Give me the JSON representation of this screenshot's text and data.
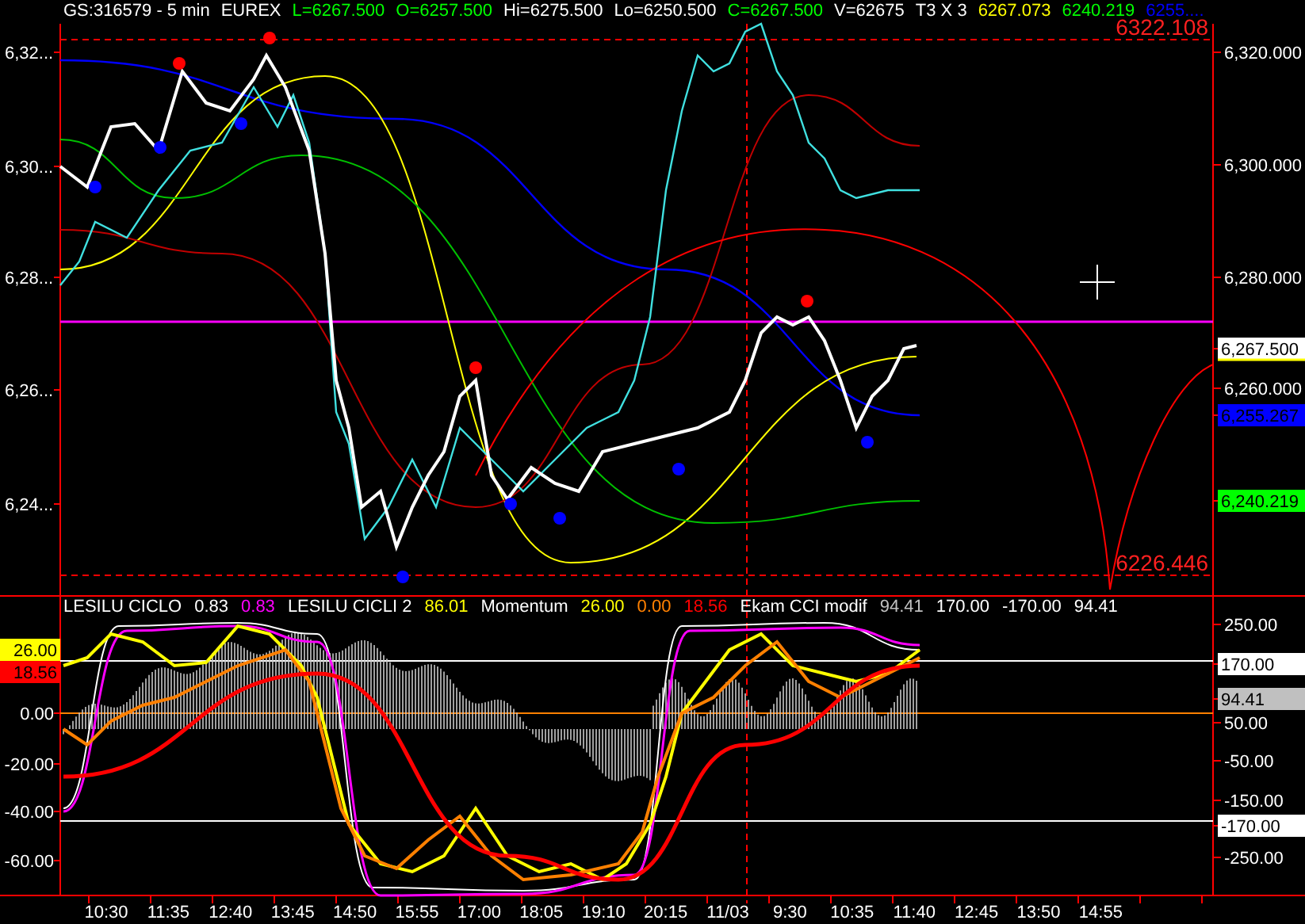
{
  "header": [
    {
      "text": "GS:316579 - 5 min",
      "color": "#ffffff"
    },
    {
      "text": "EUREX",
      "color": "#ffffff"
    },
    {
      "text": "L=6267.500",
      "color": "#00ff00"
    },
    {
      "text": "O=6257.500",
      "color": "#00ff00"
    },
    {
      "text": "Hi=6275.500",
      "color": "#ffffff"
    },
    {
      "text": "Lo=6250.500",
      "color": "#ffffff"
    },
    {
      "text": "C=6267.500",
      "color": "#00ff00"
    },
    {
      "text": "V=62675",
      "color": "#ffffff"
    },
    {
      "text": "T3 X 3",
      "color": "#ffffff"
    },
    {
      "text": "6267.073",
      "color": "#ffff00"
    },
    {
      "text": "6240.219",
      "color": "#00ff00"
    },
    {
      "text": "6255....",
      "color": "#0000ff"
    }
  ],
  "price_panel": {
    "left_ticks": [
      "6,32...",
      "6,30...",
      "6,28...",
      "6,26...",
      "6,24..."
    ],
    "right_ticks": [
      {
        "text": "6,320.000",
        "kind": "tick"
      },
      {
        "text": "6,300.000",
        "kind": "tick"
      },
      {
        "text": "6,280.000",
        "kind": "tick"
      },
      {
        "text": "6,267.500",
        "kind": "tag",
        "color": "#ffffff"
      },
      {
        "text": "6,260.000",
        "kind": "tick"
      },
      {
        "text": "6,255.267",
        "kind": "tag",
        "color": "#0000ff"
      },
      {
        "text": "6,240.219",
        "kind": "tag",
        "color": "#00ff00"
      }
    ],
    "levels": [
      "6322.108",
      "6226.446"
    ]
  },
  "indicator_panel": {
    "legend": [
      {
        "text": "LESILU CICLO",
        "color": "#ffffff"
      },
      {
        "text": "0.83",
        "color": "#ffffff"
      },
      {
        "text": "0.83",
        "color": "#ff00ff"
      },
      {
        "text": "LESILU CICLI 2",
        "color": "#ffffff"
      },
      {
        "text": "86.01",
        "color": "#ffff00"
      },
      {
        "text": "Momentum",
        "color": "#ffffff"
      },
      {
        "text": "26.00",
        "color": "#ffff00"
      },
      {
        "text": "0.00",
        "color": "#ff8000"
      },
      {
        "text": "18.56",
        "color": "#ff0000"
      },
      {
        "text": "Ekam CCI modif",
        "color": "#ffffff"
      },
      {
        "text": "94.41",
        "color": "#c0c0c0"
      },
      {
        "text": "170.00",
        "color": "#ffffff"
      },
      {
        "text": "-170.00",
        "color": "#ffffff"
      },
      {
        "text": "94.41",
        "color": "#ffffff"
      }
    ],
    "left_ticks": [
      {
        "text": "26.00",
        "kind": "tag",
        "color": "#ffff00"
      },
      {
        "text": "18.56",
        "kind": "tag",
        "color": "#ff0000"
      },
      {
        "text": "0.00",
        "kind": "tick"
      },
      {
        "text": "-20.00",
        "kind": "tick"
      },
      {
        "text": "-40.00",
        "kind": "tick"
      },
      {
        "text": "-60.00",
        "kind": "tick"
      }
    ],
    "right_ticks": [
      {
        "text": "250.00",
        "kind": "tick"
      },
      {
        "text": "170.00",
        "kind": "tag",
        "color": "#ffffff"
      },
      {
        "text": "94.41",
        "kind": "tag",
        "color": "#c0c0c0"
      },
      {
        "text": "50.00",
        "kind": "tick"
      },
      {
        "text": "-50.00",
        "kind": "tick"
      },
      {
        "text": "-150.00",
        "kind": "tick"
      },
      {
        "text": "-170.00",
        "kind": "tag",
        "color": "#ffffff"
      },
      {
        "text": "-250.00",
        "kind": "tick"
      }
    ]
  },
  "time_axis": [
    "10:30",
    "11:35",
    "12:40",
    "13:45",
    "14:50",
    "15:55",
    "17:00",
    "18:05",
    "19:10",
    "20:15",
    "11/03",
    "9:30",
    "10:35",
    "11:40",
    "12:45",
    "13:50",
    "14:55"
  ]
}
